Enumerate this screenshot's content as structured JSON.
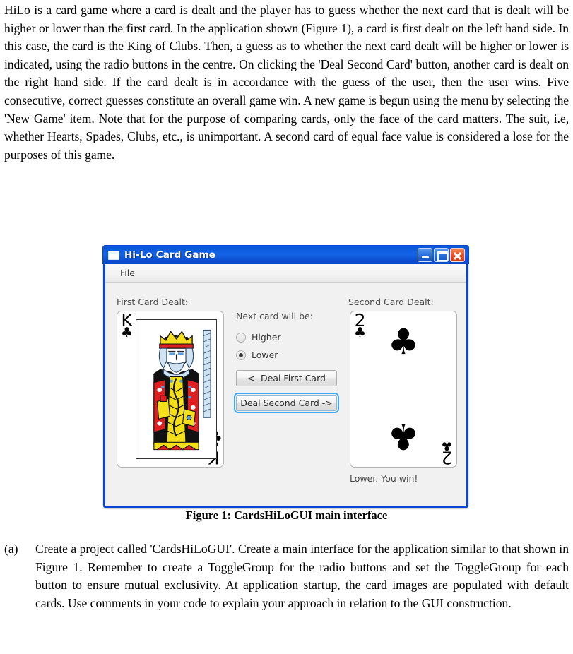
{
  "document": {
    "paragraph": "HiLo is a card game where a card is dealt and the player has to guess whether the next card that is dealt will be higher or lower than the first card. In the application shown (Figure 1), a card is first dealt on the left hand side.  In this case, the card is the King of Clubs. Then, a guess as to whether the next card dealt will be higher or lower is indicated, using the radio buttons in the centre. On clicking the 'Deal Second Card' button, another card is dealt on the right hand side. If the card dealt is in accordance with the guess of the user, then the user wins. Five consecutive, correct guesses constitute an overall game win. A new game is begun using the menu by selecting the 'New Game' item. Note that for the purpose of comparing cards, only the face of the card matters. The suit, i.e, whether Hearts, Spades, Clubs, etc., is unimportant. A second card of equal face value is considered a lose for the purposes of this game.",
    "figure_caption": "Figure 1: CardsHiLoGUI main interface",
    "item_a_marker": "(a)",
    "item_a_text": "Create a project called 'CardsHiLoGUI'. Create a main interface for the application similar to that shown in Figure 1. Remember to create a ToggleGroup for the radio buttons and set the ToggleGroup for each button to ensure mutual exclusivity. At application startup, the card images are populated with default cards. Use comments in your code to explain your approach in relation to the GUI construction."
  },
  "app": {
    "title": "Hi-Lo Card Game",
    "window_icon": "window-icon",
    "titlebar_buttons": {
      "minimize": "minimize-icon",
      "maximize": "maximize-icon",
      "close": "close-icon"
    },
    "menu": [
      {
        "label": "File"
      }
    ],
    "labels": {
      "first_card": "First Card Dealt:",
      "second_card": "Second Card Dealt:",
      "next_card_prompt": "Next card will be:"
    },
    "radios": [
      {
        "label": "Higher",
        "selected": false
      },
      {
        "label": "Lower",
        "selected": true
      }
    ],
    "buttons": [
      {
        "label": "<- Deal First Card",
        "focused": false
      },
      {
        "label": "Deal Second Card ->",
        "focused": true
      }
    ],
    "status": "Lower. You win!",
    "first_card": {
      "rank": "K",
      "suit_glyph": "♣",
      "suit_name": "clubs",
      "kind": "face"
    },
    "second_card": {
      "rank": "2",
      "suit_glyph": "♣",
      "suit_name": "clubs",
      "kind": "pip"
    },
    "colors": {
      "titlebar_blue": "#0a56d8",
      "window_border": "#0a46d2",
      "close_red": "#e8552a",
      "focus_ring": "#3fa9f5",
      "client_bg": "#f1f1f1"
    }
  }
}
